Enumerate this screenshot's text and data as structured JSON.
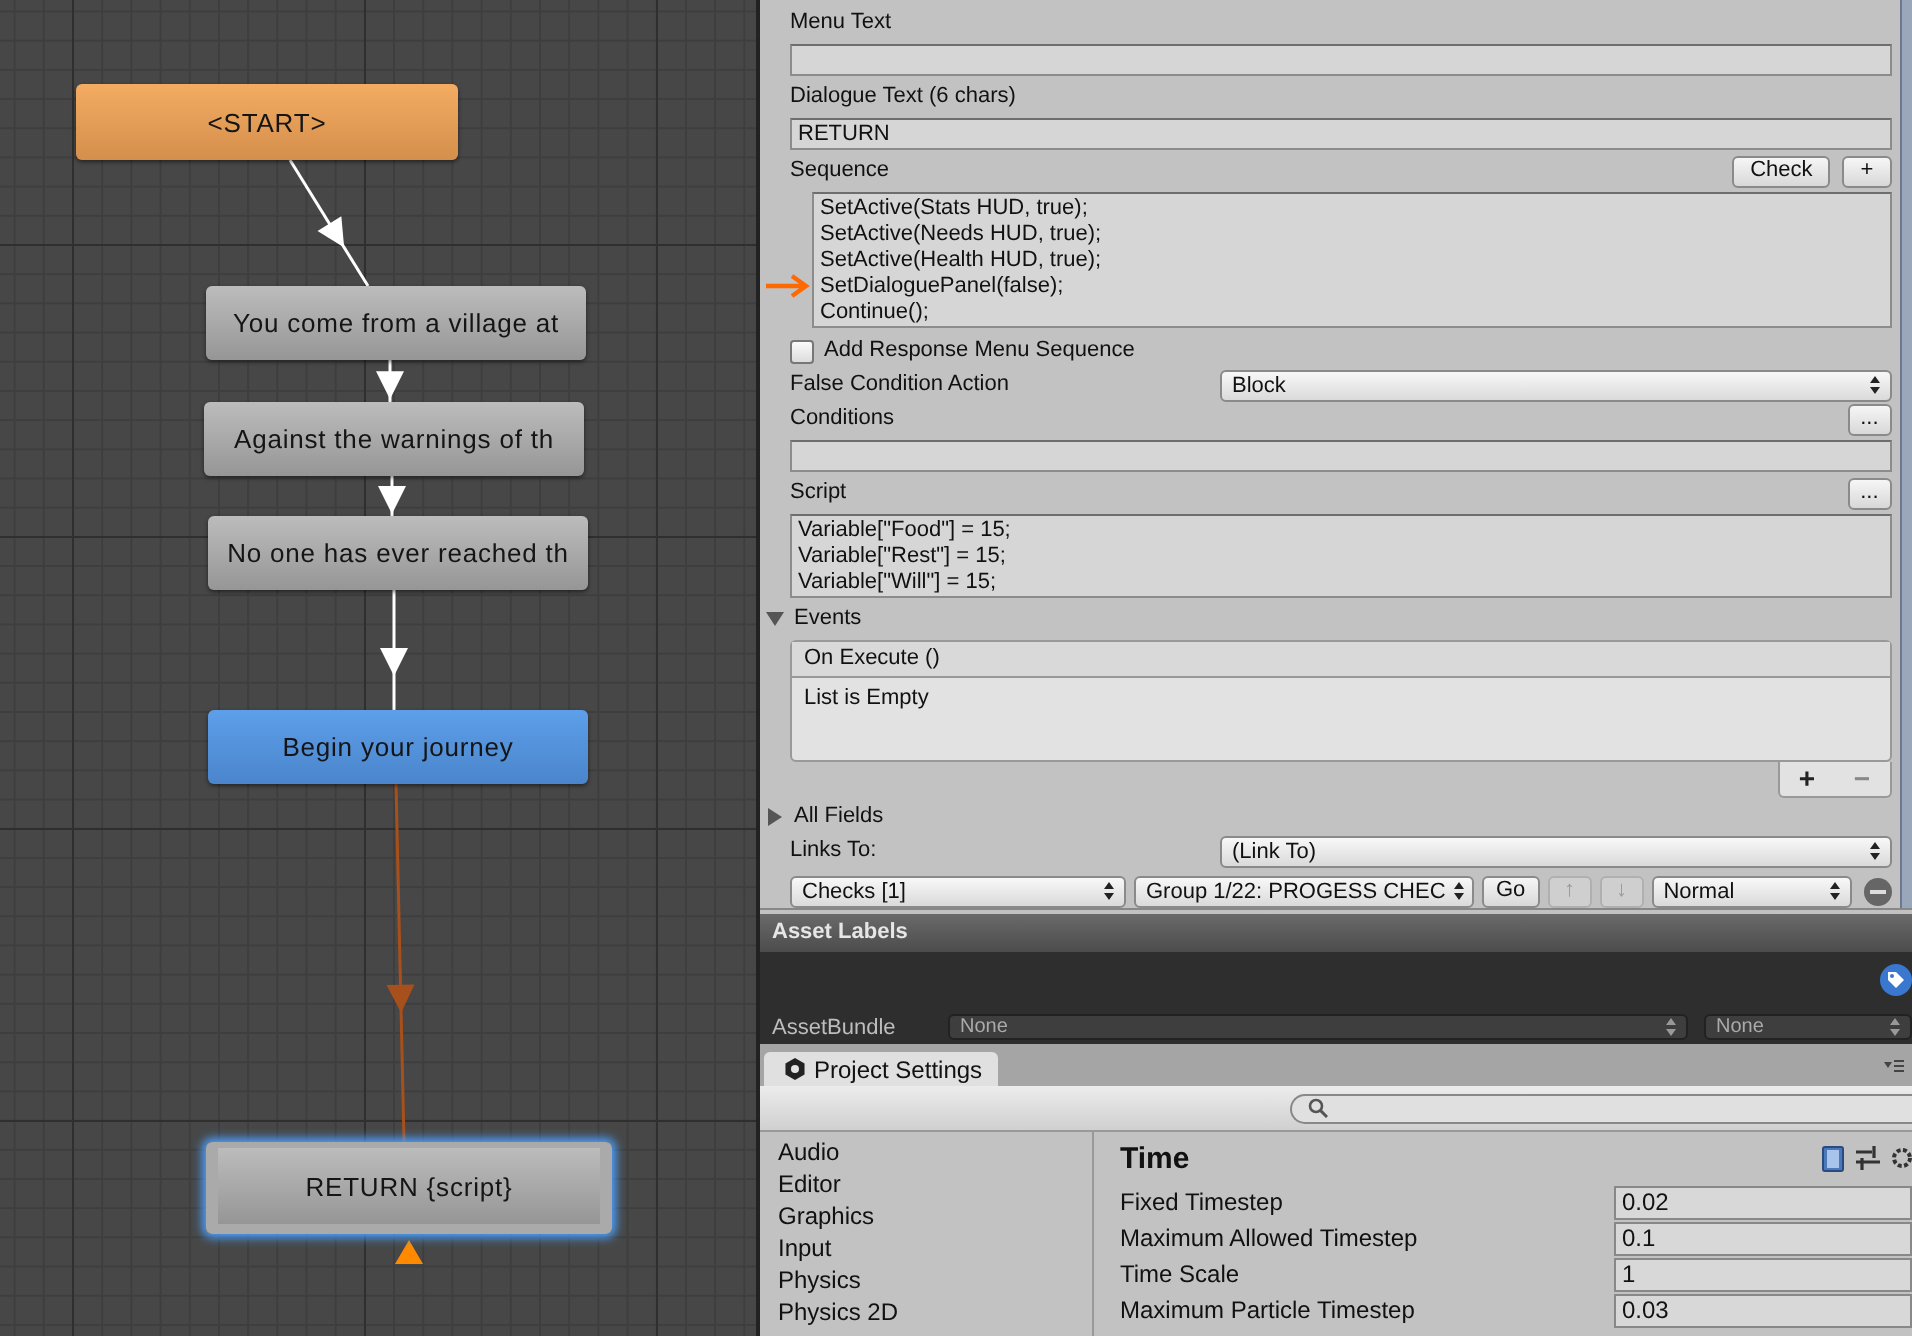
{
  "graph": {
    "nodes": [
      {
        "kind": "start",
        "text": "<START>",
        "selected": false
      },
      {
        "kind": "npc",
        "text": "You come from a village at",
        "selected": false
      },
      {
        "kind": "npc",
        "text": "Against the warnings of th",
        "selected": false
      },
      {
        "kind": "npc",
        "text": "No one has ever reached th",
        "selected": false
      },
      {
        "kind": "player",
        "text": "Begin your journey",
        "selected": false
      },
      {
        "kind": "npc",
        "text": "RETURN {script}",
        "selected": true
      }
    ]
  },
  "inspector": {
    "menu_text": {
      "label": "Menu Text"
    },
    "dialogue_text": {
      "label": "Dialogue Text (6 chars)",
      "value": "RETURN"
    },
    "sequence": {
      "label": "Sequence",
      "buttons": [
        "Check",
        "+"
      ],
      "lines": [
        "SetActive(Stats HUD, true);",
        "SetActive(Needs HUD, true);",
        "SetActive(Health HUD, true);",
        "SetDialoguePanel(false);",
        "Continue();"
      ]
    },
    "add_response_menu_sequence": {
      "label": "Add Response Menu Sequence",
      "checked": false
    },
    "false_condition_action": {
      "label": "False Condition Action",
      "value": "Block"
    },
    "conditions": {
      "label": "Conditions",
      "button": "..."
    },
    "script": {
      "label": "Script",
      "button": "...",
      "lines": [
        "Variable[\"Food\"] = 15;",
        "Variable[\"Rest\"] = 15;",
        "Variable[\"Will\"] = 15;"
      ]
    },
    "events": {
      "label": "Events",
      "expanded": true,
      "event": "On Execute ()",
      "empty_text": "List is Empty",
      "buttons": [
        "+",
        "−"
      ]
    },
    "all_fields": {
      "label": "All Fields",
      "expanded": false
    },
    "links_to": {
      "label": "Links To:",
      "value": "(Link To)"
    },
    "link_row": {
      "type": "Checks [1]",
      "target": "Group 1/22: PROGESS CHEC",
      "buttons": [
        {
          "label": "Go",
          "disabled": false
        },
        {
          "label": "↑",
          "disabled": true
        },
        {
          "label": "↓",
          "disabled": true
        }
      ],
      "priority": "Normal"
    }
  },
  "asset_labels": {
    "title": "Asset Labels",
    "asset_bundle": {
      "label": "AssetBundle",
      "values": [
        "None",
        "None"
      ]
    }
  },
  "project_settings": {
    "tab": "Project Settings",
    "categories": [
      "Audio",
      "Editor",
      "Graphics",
      "Input",
      "Physics",
      "Physics 2D"
    ],
    "title": "Time",
    "fields": [
      {
        "label": "Fixed Timestep",
        "value": "0.02"
      },
      {
        "label": "Maximum Allowed Timestep",
        "value": "0.1"
      },
      {
        "label": "Time Scale",
        "value": "1"
      },
      {
        "label": "Maximum Particle Timestep",
        "value": "0.03"
      }
    ]
  }
}
